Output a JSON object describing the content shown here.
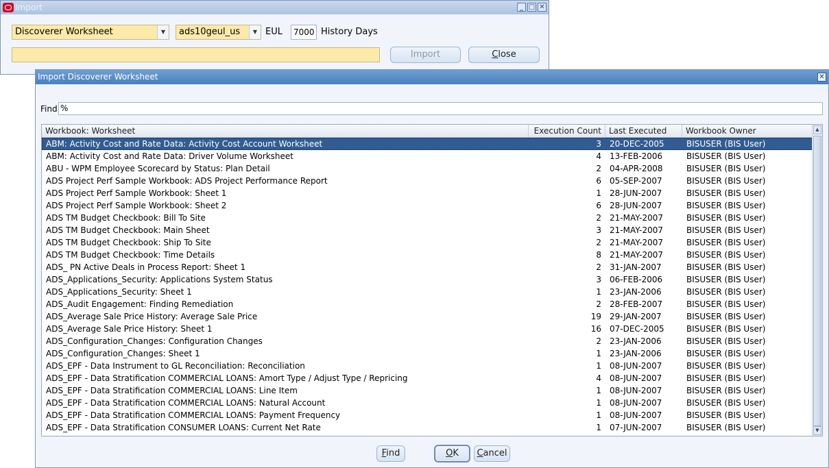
{
  "import_window": {
    "title": "Import",
    "type_select": "Discoverer Worksheet",
    "eul_select": "ads10geul_us",
    "eul_label": "EUL",
    "history_days_value": "7000",
    "history_days_label": "History Days",
    "message_value": "",
    "import_button": "Import",
    "close_button": "Close",
    "close_button_key": "C",
    "close_button_rest": "lose"
  },
  "dialog": {
    "title": "Import Discoverer Worksheet",
    "find_label": "Find",
    "find_value": "%",
    "columns": [
      "Workbook: Worksheet",
      "Execution Count",
      "Last Executed",
      "Workbook Owner"
    ],
    "rows": [
      {
        "worksheet": "ABM: Activity Cost and Rate Data: Activity Cost Account Worksheet",
        "count": "3",
        "last": "20-DEC-2005",
        "owner": "BISUSER (BIS User)"
      },
      {
        "worksheet": "ABM: Activity Cost and Rate Data: Driver Volume Worksheet",
        "count": "4",
        "last": "13-FEB-2006",
        "owner": "BISUSER (BIS User)"
      },
      {
        "worksheet": "ABU - WPM Employee Scorecard by Status: Plan Detail",
        "count": "2",
        "last": "04-APR-2008",
        "owner": "BISUSER (BIS User)"
      },
      {
        "worksheet": "ADS Project Perf Sample Workbook: ADS Project Performance Report",
        "count": "6",
        "last": "05-SEP-2007",
        "owner": "BISUSER (BIS User)"
      },
      {
        "worksheet": "ADS Project Perf Sample Workbook: Sheet 1",
        "count": "1",
        "last": "28-JUN-2007",
        "owner": "BISUSER (BIS User)"
      },
      {
        "worksheet": "ADS Project Perf Sample Workbook: Sheet 2",
        "count": "6",
        "last": "28-JUN-2007",
        "owner": "BISUSER (BIS User)"
      },
      {
        "worksheet": "ADS TM Budget Checkbook: Bill To Site",
        "count": "2",
        "last": "21-MAY-2007",
        "owner": "BISUSER (BIS User)"
      },
      {
        "worksheet": "ADS TM Budget Checkbook: Main Sheet",
        "count": "3",
        "last": "21-MAY-2007",
        "owner": "BISUSER (BIS User)"
      },
      {
        "worksheet": "ADS TM Budget Checkbook: Ship To Site",
        "count": "2",
        "last": "21-MAY-2007",
        "owner": "BISUSER (BIS User)"
      },
      {
        "worksheet": "ADS TM Budget Checkbook: Time Details",
        "count": "8",
        "last": "21-MAY-2007",
        "owner": "BISUSER (BIS User)"
      },
      {
        "worksheet": "ADS_ PN Active Deals in Process Report: Sheet 1",
        "count": "2",
        "last": "31-JAN-2007",
        "owner": "BISUSER (BIS User)"
      },
      {
        "worksheet": "ADS_Applications_Security: Applications System Status",
        "count": "3",
        "last": "06-FEB-2006",
        "owner": "BISUSER (BIS User)"
      },
      {
        "worksheet": "ADS_Applications_Security: Sheet 1",
        "count": "1",
        "last": "23-JAN-2006",
        "owner": "BISUSER (BIS User)"
      },
      {
        "worksheet": "ADS_Audit Engagement: Finding Remediation",
        "count": "2",
        "last": "28-FEB-2007",
        "owner": "BISUSER (BIS User)"
      },
      {
        "worksheet": "ADS_Average Sale Price History: Average Sale Price",
        "count": "19",
        "last": "29-JAN-2007",
        "owner": "BISUSER (BIS User)"
      },
      {
        "worksheet": "ADS_Average Sale Price History: Sheet 1",
        "count": "16",
        "last": "07-DEC-2005",
        "owner": "BISUSER (BIS User)"
      },
      {
        "worksheet": "ADS_Configuration_Changes: Configuration Changes",
        "count": "2",
        "last": "23-JAN-2006",
        "owner": "BISUSER (BIS User)"
      },
      {
        "worksheet": "ADS_Configuration_Changes: Sheet 1",
        "count": "1",
        "last": "23-JAN-2006",
        "owner": "BISUSER (BIS User)"
      },
      {
        "worksheet": "ADS_EPF - Data Instrument to GL Reconciliation: Reconciliation",
        "count": "1",
        "last": "08-JUN-2007",
        "owner": "BISUSER (BIS User)"
      },
      {
        "worksheet": "ADS_EPF - Data Stratification COMMERCIAL LOANS: Amort Type / Adjust Type / Repricing",
        "count": "4",
        "last": "08-JUN-2007",
        "owner": "BISUSER (BIS User)"
      },
      {
        "worksheet": "ADS_EPF - Data Stratification COMMERCIAL LOANS: Line Item",
        "count": "1",
        "last": "08-JUN-2007",
        "owner": "BISUSER (BIS User)"
      },
      {
        "worksheet": "ADS_EPF - Data Stratification COMMERCIAL LOANS: Natural Account",
        "count": "1",
        "last": "08-JUN-2007",
        "owner": "BISUSER (BIS User)"
      },
      {
        "worksheet": "ADS_EPF - Data Stratification COMMERCIAL LOANS: Payment Frequency",
        "count": "1",
        "last": "08-JUN-2007",
        "owner": "BISUSER (BIS User)"
      },
      {
        "worksheet": "ADS_EPF - Data Stratification CONSUMER LOANS: Current Net Rate",
        "count": "1",
        "last": "07-JUN-2007",
        "owner": "BISUSER (BIS User)"
      }
    ],
    "selected_row": 0,
    "find_button_key": "F",
    "find_button_rest": "ind",
    "ok_button_key": "O",
    "ok_button_rest": "K",
    "cancel_button_key": "C",
    "cancel_button_rest": "ancel"
  }
}
